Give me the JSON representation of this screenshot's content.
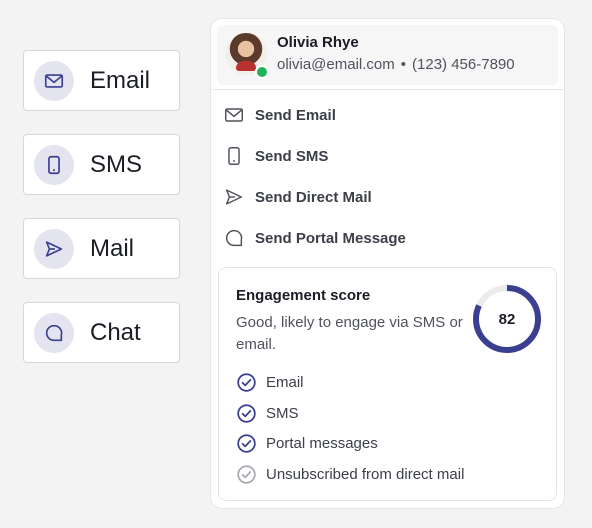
{
  "channels": [
    {
      "label": "Email",
      "icon": "envelope-icon"
    },
    {
      "label": "SMS",
      "icon": "phone-icon"
    },
    {
      "label": "Mail",
      "icon": "send-icon"
    },
    {
      "label": "Chat",
      "icon": "chat-icon"
    }
  ],
  "contact": {
    "name": "Olivia Rhye",
    "email": "olivia@email.com",
    "separator": "•",
    "phone": "(123) 456-7890",
    "status": "online"
  },
  "actions": [
    {
      "label": "Send Email",
      "icon": "envelope-icon"
    },
    {
      "label": "Send SMS",
      "icon": "phone-icon"
    },
    {
      "label": "Send Direct Mail",
      "icon": "send-icon"
    },
    {
      "label": "Send Portal Message",
      "icon": "chat-icon"
    }
  ],
  "engagement": {
    "title": "Engagement score",
    "description": "Good, likely to engage via SMS or email.",
    "score": 82,
    "score_fraction": 0.82,
    "items": [
      {
        "label": "Email",
        "active": true
      },
      {
        "label": "SMS",
        "active": true
      },
      {
        "label": "Portal messages",
        "active": true
      },
      {
        "label": "Unsubscribed from direct mail",
        "active": false
      }
    ]
  },
  "colors": {
    "accent": "#3a3f8f",
    "accent_soft": "#e3e4ef",
    "online": "#22b35a",
    "muted": "#a7a9b0"
  }
}
